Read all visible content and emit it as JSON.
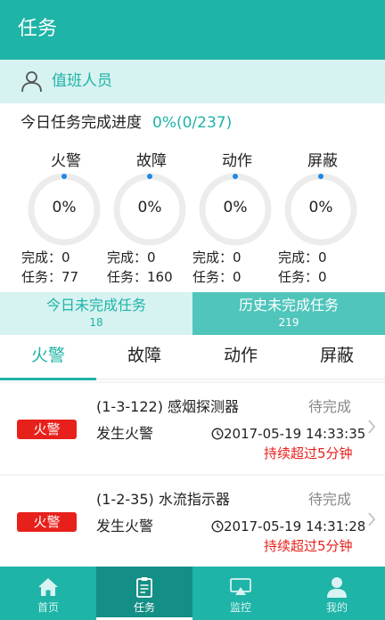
{
  "header": {
    "title": "任务"
  },
  "duty": {
    "label": "值班人员",
    "icon": "person-icon"
  },
  "progress": {
    "label": "今日任务完成进度",
    "value": "0%(0/237)"
  },
  "stats": [
    {
      "name": "火警",
      "percent": "0%",
      "done_label": "完成：",
      "done": "0",
      "task_label": "任务：",
      "task": "77"
    },
    {
      "name": "故障",
      "percent": "0%",
      "done_label": "完成：",
      "done": "0",
      "task_label": "任务：",
      "task": "160"
    },
    {
      "name": "动作",
      "percent": "0%",
      "done_label": "完成：",
      "done": "0",
      "task_label": "任务：",
      "task": "0"
    },
    {
      "name": "屏蔽",
      "percent": "0%",
      "done_label": "完成：",
      "done": "0",
      "task_label": "任务：",
      "task": "0"
    }
  ],
  "switch": [
    {
      "label": "今日未完成任务",
      "count": "18"
    },
    {
      "label": "历史未完成任务",
      "count": "219"
    }
  ],
  "tabs": [
    "火警",
    "故障",
    "动作",
    "屏蔽"
  ],
  "items": [
    {
      "badge": "火警",
      "name": "(1-3-122) 感烟探测器",
      "status": "待完成",
      "event": "发生火警",
      "time": "2017-05-19 14:33:35",
      "warning": "持续超过5分钟"
    },
    {
      "badge": "火警",
      "name": "(1-2-35) 水流指示器",
      "status": "待完成",
      "event": "发生火警",
      "time": "2017-05-19 14:31:28",
      "warning": "持续超过5分钟"
    }
  ],
  "nav": [
    {
      "label": "首页",
      "icon": "home-icon"
    },
    {
      "label": "任务",
      "icon": "clipboard-icon"
    },
    {
      "label": "监控",
      "icon": "monitor-icon"
    },
    {
      "label": "我的",
      "icon": "user-icon"
    }
  ],
  "colors": {
    "accent": "#1eb4a7",
    "alert": "#e8201b",
    "light_accent": "#d6f2f1",
    "progress_dot": "#1e88e5"
  }
}
